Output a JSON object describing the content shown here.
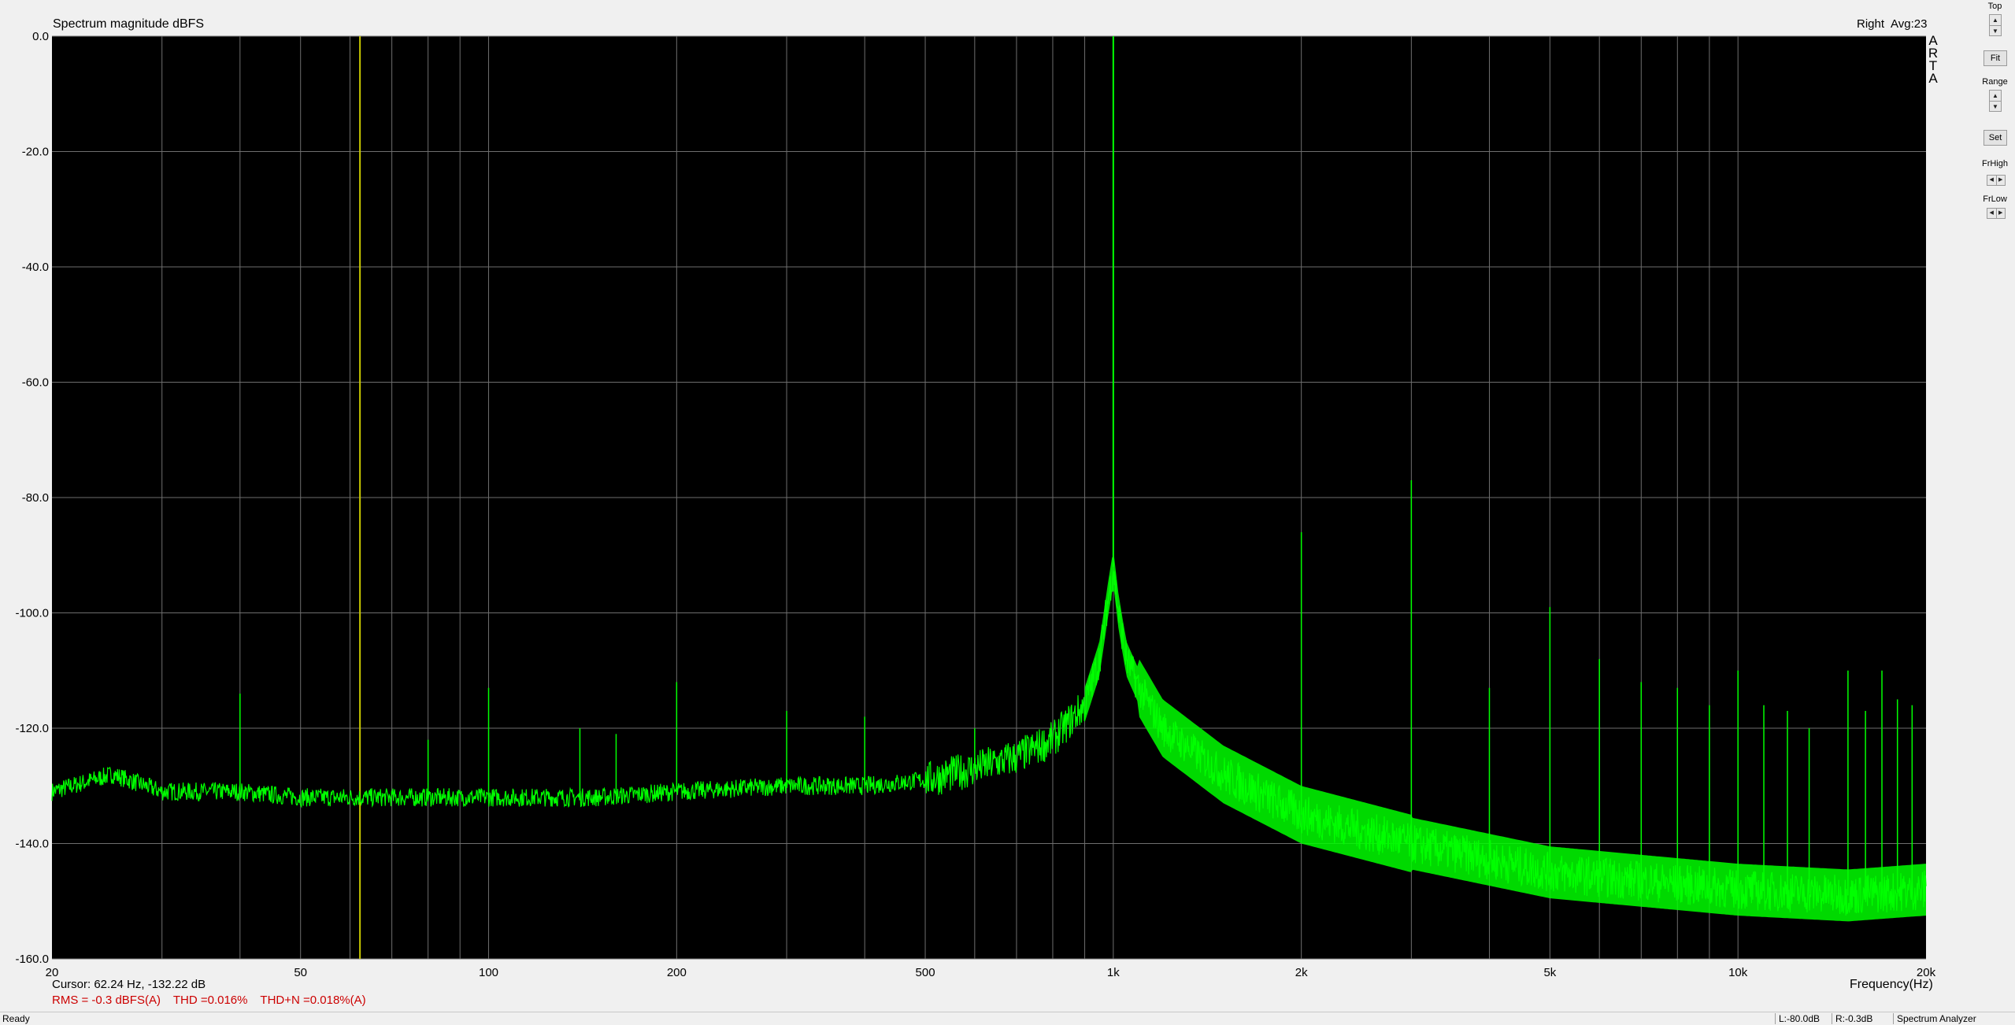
{
  "window": {
    "title": "Spectrum magnitude dBFS",
    "channel": "Right",
    "avg": "Avg:23",
    "logo_letters": [
      "A",
      "R",
      "T",
      "A"
    ]
  },
  "controls": {
    "top_label": "Top",
    "fit_label": "Fit",
    "range_label": "Range",
    "set_label": "Set",
    "frhigh_label": "FrHigh",
    "frlow_label": "FrLow"
  },
  "readouts": {
    "cursor": "Cursor: 62.24 Hz, -132.22 dB",
    "rms": "RMS =  -0.3 dBFS(A)",
    "thd": "THD =0.016%",
    "thdn": "THD+N =0.018%(A)"
  },
  "status": {
    "ready": "Ready",
    "left_level": "L:-80.0dB",
    "right_level": "R:-0.3dB",
    "mode": "Spectrum Analyzer"
  },
  "colors": {
    "background": "#000000",
    "trace": "#00ff00",
    "grid": "#6e6e6e",
    "cursor": "#c8c800",
    "measurement_text": "#cc0000"
  },
  "chart_data": {
    "type": "line",
    "title": "Spectrum magnitude dBFS",
    "xlabel": "Frequency(Hz)",
    "ylabel": "",
    "x_scale": "log",
    "xlim": [
      20,
      20000
    ],
    "ylim": [
      -160,
      0
    ],
    "grid": true,
    "y_ticks": [
      0,
      -20,
      -40,
      -60,
      -80,
      -100,
      -120,
      -140,
      -160
    ],
    "y_tick_labels": [
      "0.0",
      "-20.0",
      "-40.0",
      "-60.0",
      "-80.0",
      "-100.0",
      "-120.0",
      "-140.0",
      "-160.0"
    ],
    "x_ticks": [
      20,
      50,
      100,
      200,
      500,
      1000,
      2000,
      5000,
      10000,
      20000
    ],
    "x_tick_labels": [
      "20",
      "50",
      "100",
      "200",
      "500",
      "1k",
      "2k",
      "5k",
      "10k",
      "20k"
    ],
    "cursor_hz": 62.24,
    "series": [
      {
        "x": [
          20,
          25,
          30,
          40,
          50,
          70,
          100,
          150,
          200,
          300,
          400,
          500,
          600,
          700,
          800,
          900,
          950,
          980,
          1000,
          1020,
          1050,
          1100,
          1200,
          1500,
          2000,
          3000,
          5000,
          10000,
          15000,
          20000
        ],
        "y": [
          -131,
          -128,
          -131,
          -131,
          -132,
          -132,
          -132,
          -132,
          -131,
          -130,
          -130,
          -129,
          -127,
          -125,
          -122,
          -116,
          -108,
          -98,
          -92,
          -100,
          -108,
          -113,
          -120,
          -128,
          -135,
          -140,
          -145,
          -148,
          -149,
          -148
        ]
      }
    ],
    "peaks": [
      {
        "x": 40,
        "y": -114
      },
      {
        "x": 80,
        "y": -122
      },
      {
        "x": 100,
        "y": -113
      },
      {
        "x": 140,
        "y": -120
      },
      {
        "x": 160,
        "y": -121
      },
      {
        "x": 200,
        "y": -112
      },
      {
        "x": 300,
        "y": -117
      },
      {
        "x": 400,
        "y": -118
      },
      {
        "x": 600,
        "y": -120
      },
      {
        "x": 1000,
        "y": 0
      },
      {
        "x": 2000,
        "y": -86
      },
      {
        "x": 3000,
        "y": -77
      },
      {
        "x": 4000,
        "y": -113
      },
      {
        "x": 5000,
        "y": -99
      },
      {
        "x": 6000,
        "y": -108
      },
      {
        "x": 7000,
        "y": -112
      },
      {
        "x": 8000,
        "y": -113
      },
      {
        "x": 9000,
        "y": -116
      },
      {
        "x": 10000,
        "y": -110
      },
      {
        "x": 11000,
        "y": -116
      },
      {
        "x": 12000,
        "y": -117
      },
      {
        "x": 13000,
        "y": -120
      },
      {
        "x": 15000,
        "y": -110
      },
      {
        "x": 16000,
        "y": -117
      },
      {
        "x": 17000,
        "y": -110
      },
      {
        "x": 18000,
        "y": -115
      },
      {
        "x": 19000,
        "y": -116
      }
    ]
  }
}
